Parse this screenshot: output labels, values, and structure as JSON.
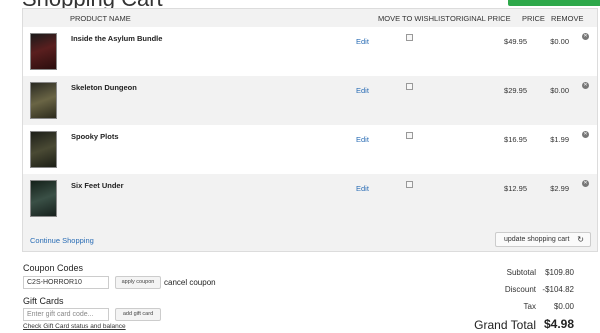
{
  "page": {
    "title": "Shopping Cart"
  },
  "header": {
    "product_name": "PRODUCT NAME",
    "move_to_wishlist": "MOVE TO WISHLIST",
    "original_price": "ORIGINAL PRICE",
    "price": "PRICE",
    "remove": "REMOVE"
  },
  "items": [
    {
      "name": "Inside the Asylum Bundle",
      "edit": "Edit",
      "original_price": "$49.95",
      "price": "$0.00",
      "thumb_color": "#4a2020"
    },
    {
      "name": "Skeleton Dungeon",
      "edit": "Edit",
      "original_price": "$29.95",
      "price": "$0.00",
      "thumb_color": "#3b3a2a"
    },
    {
      "name": "Spooky Plots",
      "edit": "Edit",
      "original_price": "$16.95",
      "price": "$1.99",
      "thumb_color": "#2a2d22"
    },
    {
      "name": "Six Feet Under",
      "edit": "Edit",
      "original_price": "$12.95",
      "price": "$2.99",
      "thumb_color": "#23302b"
    }
  ],
  "actions": {
    "continue_shopping": "Continue Shopping",
    "update_cart": "update shopping cart"
  },
  "coupon": {
    "label": "Coupon Codes",
    "value": "C2S-HORROR10",
    "apply_label": "apply coupon",
    "cancel_label": "cancel coupon"
  },
  "gift": {
    "label": "Gift Cards",
    "placeholder": "Enter gift card code...",
    "add_label": "add gift card",
    "check_link": "Check Gift Card status and balance"
  },
  "summary": {
    "subtotal_label": "Subtotal",
    "subtotal_value": "$109.80",
    "discount_label": "Discount",
    "discount_value": "-$104.82",
    "tax_label": "Tax",
    "tax_value": "$0.00",
    "grand_total_label": "Grand Total",
    "grand_total_value": "$4.98"
  },
  "colors": {
    "link": "#2a6db5",
    "checkout_button": "#2ea84a"
  },
  "icons": {
    "remove": "close-circle-icon",
    "update": "refresh-icon"
  }
}
